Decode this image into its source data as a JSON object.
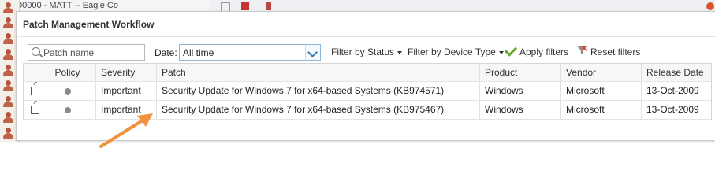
{
  "background": {
    "title": "00000 - MATT -- Eagle Co"
  },
  "dialog": {
    "title": "Patch Management Workflow"
  },
  "toolbar": {
    "search_placeholder": "Patch name",
    "date_label": "Date:",
    "date_value": "All time",
    "filter_status": "Filter by Status",
    "filter_device": "Filter by Device Type",
    "apply": "Apply filters",
    "reset": "Reset filters"
  },
  "table": {
    "columns": [
      "Policy",
      "Severity",
      "Patch",
      "Product",
      "Vendor",
      "Release Date"
    ],
    "rows": [
      {
        "severity": "Important",
        "patch": "Security Update for Windows 7 for x64-based Systems (KB974571)",
        "product": "Windows",
        "vendor": "Microsoft",
        "release": "13-Oct-2009"
      },
      {
        "severity": "Important",
        "patch": "Security Update for Windows 7 for x64-based Systems (KB975467)",
        "product": "Windows",
        "vendor": "Microsoft",
        "release": "13-Oct-2009"
      }
    ]
  },
  "colors": {
    "accent_blue": "#2e79b7",
    "apply_green": "#6aa82e",
    "annotation_arrow": "#f0923c"
  }
}
